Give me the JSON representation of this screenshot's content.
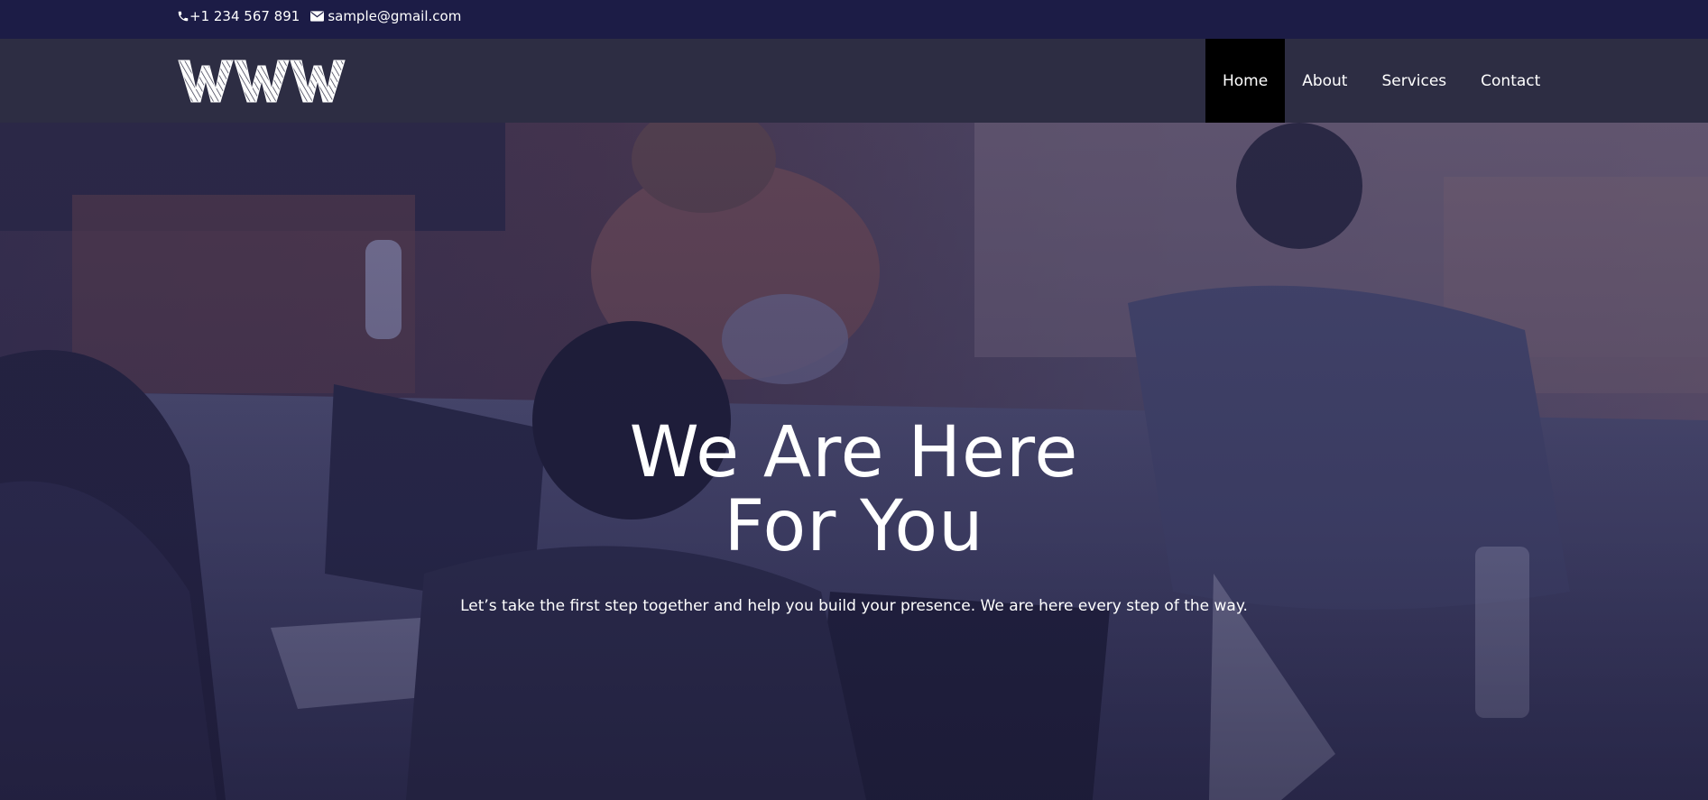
{
  "topbar": {
    "phone": "+1 234 567 891",
    "email": "sample@gmail.com",
    "phone_icon": "phone-icon",
    "email_icon": "envelope-icon",
    "background": "#1c1c46"
  },
  "header": {
    "logo_text": "WWW",
    "background": "#2d2d43",
    "nav": [
      {
        "label": "Home",
        "active": true
      },
      {
        "label": "About",
        "active": false
      },
      {
        "label": "Services",
        "active": false
      },
      {
        "label": "Contact",
        "active": false
      }
    ],
    "active_background": "#000000"
  },
  "hero": {
    "title_line1": "We Are Here",
    "title_line2": "For You",
    "subtitle": "Let’s take the first step together and help you build your presence. We are here every step of the way.",
    "overlay_color": "#2a2852"
  }
}
